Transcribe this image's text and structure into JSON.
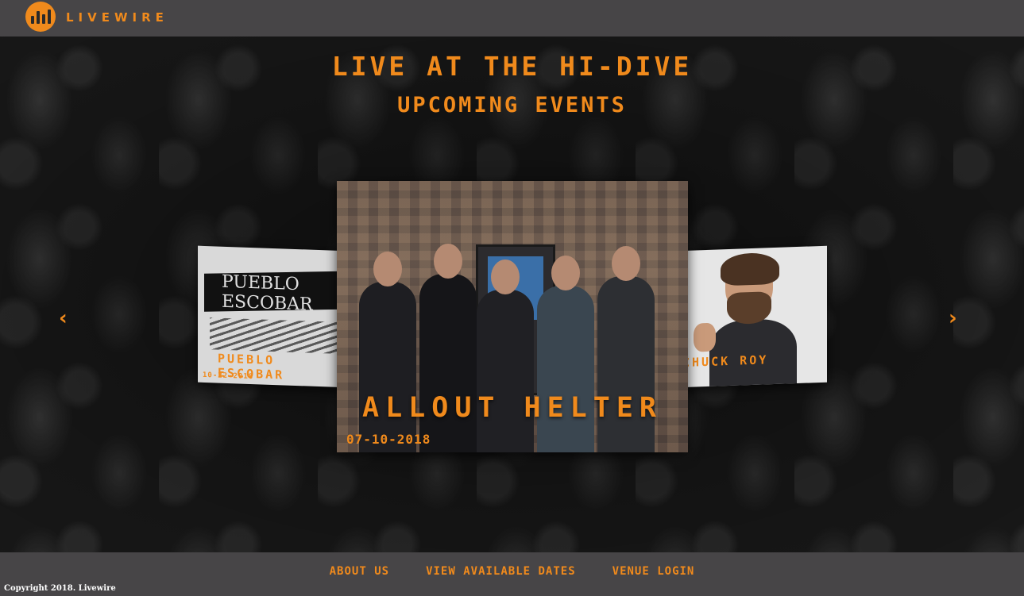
{
  "header": {
    "brand": "LIVEWIRE",
    "logo_icon": "equalizer-bars-icon",
    "accent_color": "#f08a1c",
    "bar_color": "#474547"
  },
  "hero": {
    "title": "LIVE AT THE HI-DIVE",
    "subtitle": "UPCOMING EVENTS"
  },
  "carousel": {
    "prev_icon": "‹",
    "next_icon": "›",
    "cards": [
      {
        "position": "left",
        "name": "PUEBLO ESCOBAR",
        "date": "10-22-2018",
        "banner_text": "PUEBLO ESCOBAR"
      },
      {
        "position": "center",
        "name": "ALLOUT HELTER",
        "date": "07-10-2018"
      },
      {
        "position": "right",
        "name": "CHUCK ROY",
        "date": ""
      }
    ]
  },
  "footer": {
    "links": [
      "ABOUT US",
      "VIEW AVAILABLE DATES",
      "VENUE LOGIN"
    ],
    "copyright": "Copyright 2018. Livewire"
  }
}
